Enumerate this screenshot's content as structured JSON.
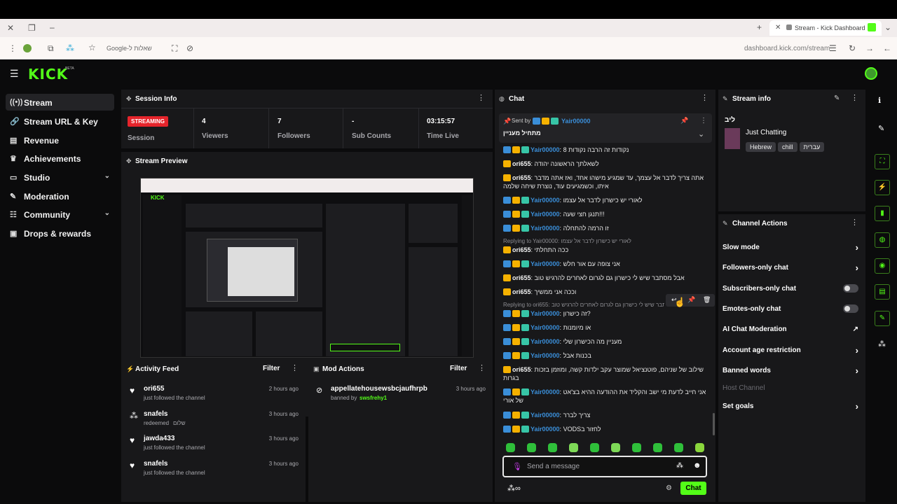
{
  "browser": {
    "tab_title": "Stream - Kick Dashboard",
    "address": "dashboard.kick.com/stream",
    "bookmark_label": "Google-שאלות ל"
  },
  "app": {
    "logo": "KICK",
    "logo_tag": "BETA"
  },
  "sidebar": {
    "items": [
      {
        "label": "Stream",
        "icon": "broadcast-icon"
      },
      {
        "label": "Stream URL & Key",
        "icon": "link-icon"
      },
      {
        "label": "Revenue",
        "icon": "chart-icon"
      },
      {
        "label": "Achievements",
        "icon": "trophy-icon"
      },
      {
        "label": "Studio",
        "icon": "monitor-icon"
      },
      {
        "label": "Moderation",
        "icon": "wrench-icon"
      },
      {
        "label": "Community",
        "icon": "users-icon"
      },
      {
        "label": "Drops & rewards",
        "icon": "gift-icon"
      }
    ]
  },
  "session": {
    "title": "Session Info",
    "status_badge": "STREAMING",
    "status_label": "Session",
    "stats": [
      {
        "value": "4",
        "label": "Viewers"
      },
      {
        "value": "7",
        "label": "Followers"
      },
      {
        "value": "-",
        "label": "Sub Counts"
      },
      {
        "value": "03:15:57",
        "label": "Time Live"
      }
    ]
  },
  "preview": {
    "title": "Stream Preview"
  },
  "activity": {
    "title": "Activity Feed",
    "filter": "Filter",
    "items": [
      {
        "name": "ori655",
        "action": "just followed the channel",
        "time": "2 hours ago"
      },
      {
        "name": "snafels",
        "action": "redeemed",
        "reward": "שלום",
        "time": "3 hours ago"
      },
      {
        "name": "jawda433",
        "action": "just followed the channel",
        "time": "3 hours ago"
      },
      {
        "name": "snafels",
        "action": "just followed the channel",
        "time": "3 hours ago"
      }
    ]
  },
  "mod_actions": {
    "title": "Mod Actions",
    "filter": "Filter",
    "items": [
      {
        "target": "appellatehousewsbcjaufhrpb",
        "action": "banned by",
        "by": "swsfrehy1",
        "time": "3 hours ago"
      }
    ]
  },
  "chat": {
    "title": "Chat",
    "pinned": {
      "sent_by": "Sent by",
      "user": "Yair00000",
      "message": "מתחיל מעניין"
    },
    "messages": [
      {
        "user": "Yair00000",
        "text": "נקודות זה הרבה נקודות 8",
        "badges": [
          "mod",
          "crown",
          "sub"
        ]
      },
      {
        "user": "ori655",
        "text": "לשאלתך הראשונה יהודה",
        "badges": [
          "crown"
        ]
      },
      {
        "user": "ori655",
        "text": "אתה צריך לדבר אל עצמך, עד שמגיע מישהו אחד, ואז אתה מדבר איתו, וכשמגיעים עוד, נוצרת שיחה שלמה",
        "badges": [
          "crown"
        ]
      },
      {
        "user": "Yair00000",
        "text": "לאורי יש כישרון לדבר אל עצמו",
        "badges": [
          "mod",
          "crown",
          "sub"
        ]
      },
      {
        "user": "Yair00000",
        "text": "תנגן חצי שעה!!!",
        "badges": [
          "mod",
          "crown",
          "sub"
        ]
      },
      {
        "user": "Yair00000",
        "text": "זו הרמה להתחלה",
        "badges": [
          "mod",
          "crown",
          "sub"
        ]
      },
      {
        "reply": "Replying to Yair00000: לאורי יש כישרון לדבר אל עצמו",
        "user": "ori655",
        "text": "ככה התחלתי",
        "badges": [
          "crown"
        ]
      },
      {
        "user": "Yair00000",
        "text": "אני צופה עם אור חלש",
        "badges": [
          "mod",
          "crown",
          "sub"
        ]
      },
      {
        "user": "ori655",
        "text": "אבל מסתבר שיש לי כישרון גם לגרום לאחרים להרגיש טוב",
        "badges": [
          "crown"
        ]
      },
      {
        "user": "ori655",
        "text": "וככה אני ממשיך",
        "badges": [
          "crown"
        ]
      },
      {
        "reply": "Replying to ori655: אבל מסתבר שיש לי כישרון גם לגרום לאחרים להרגיש טוב",
        "user": "Yair00000",
        "text": "זה כישרון?",
        "badges": [
          "mod",
          "crown",
          "sub"
        ]
      },
      {
        "user": "Yair00000",
        "text": "או מיומנות",
        "badges": [
          "mod",
          "crown",
          "sub"
        ]
      },
      {
        "user": "Yair00000",
        "text": "מעניין מה הכישרון שלי",
        "badges": [
          "mod",
          "crown",
          "sub"
        ]
      },
      {
        "user": "Yair00000",
        "text": "בכנות אבל",
        "badges": [
          "mod",
          "crown",
          "sub"
        ]
      },
      {
        "user": "ori655",
        "text": "שילוב של שניהם, פוטנציאל שמוצר עקב ילדות קשה, ומוזמן בזכות בגרות",
        "badges": [
          "crown"
        ]
      },
      {
        "user": "Yair00000",
        "text": "אני חייב לדעת מי ישב והקליד את ההודעה ההיא בצ'אט של אורי",
        "badges": [
          "mod",
          "crown",
          "sub"
        ]
      },
      {
        "user": "Yair00000",
        "text": "צריך לברר",
        "badges": [
          "mod",
          "crown",
          "sub"
        ]
      },
      {
        "user": "Yair00000",
        "text": "VODSלחזור ב",
        "badges": [
          "mod",
          "crown",
          "sub"
        ]
      }
    ],
    "input_placeholder": "Send a message",
    "send_label": "Chat"
  },
  "stream_info": {
    "title": "Stream info",
    "stream_title": "ליב",
    "category": "Just Chatting",
    "tags": [
      "Hebrew",
      "chill",
      "עברית"
    ]
  },
  "channel_actions": {
    "title": "Channel Actions",
    "items": [
      {
        "label": "Slow mode",
        "control": "chevron"
      },
      {
        "label": "Followers-only chat",
        "control": "chevron"
      },
      {
        "label": "Subscribers-only chat",
        "control": "toggle"
      },
      {
        "label": "Emotes-only chat",
        "control": "toggle"
      },
      {
        "label": "AI Chat Moderation",
        "control": "external"
      },
      {
        "label": "Account age restriction",
        "control": "chevron"
      },
      {
        "label": "Banned words",
        "control": "chevron"
      },
      {
        "label": "Host Channel",
        "control": "none",
        "disabled": true
      },
      {
        "label": "Set goals",
        "control": "chevron"
      }
    ]
  },
  "colors": {
    "brand": "#53fc18",
    "panel": "#18181a",
    "streaming": "#e5242b",
    "mod_badge": "#3a8ed8"
  }
}
